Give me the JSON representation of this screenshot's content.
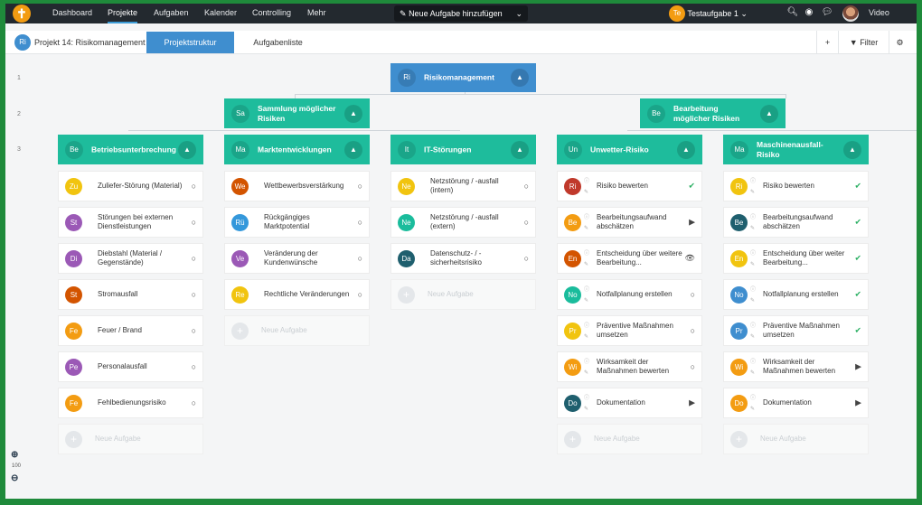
{
  "nav": {
    "logo": "✝",
    "items": [
      "Dashboard",
      "Projekte",
      "Aufgaben",
      "Kalender",
      "Controlling",
      "Mehr"
    ],
    "new_task": "Neue Aufgabe hinzufügen",
    "user_badge": "Te",
    "user_task": "Testaufgabe 1",
    "video": "Video"
  },
  "project": {
    "badge": "Ri",
    "name": "Projekt 14: Risikomanagement",
    "tabs": [
      "Projektstruktur",
      "Aufgabenliste"
    ],
    "filter": "Filter"
  },
  "rows": [
    "1",
    "2",
    "3"
  ],
  "root": {
    "badge": "Ri",
    "title": "Risikomanagement"
  },
  "level2": [
    {
      "badge": "Sa",
      "title": "Sammlung möglicher Risiken"
    },
    {
      "badge": "Be",
      "title": "Bearbeitung möglicher Risiken"
    }
  ],
  "columns": [
    {
      "badge": "Be",
      "title": "Betriebsunterbrechung",
      "tasks": [
        {
          "badge": "Zu",
          "label": "Zuliefer-Störung (Material)",
          "color": "#f1c40f",
          "status": "○"
        },
        {
          "badge": "St",
          "label": "Störungen bei externen Dienstleistungen",
          "color": "#9b59b6",
          "status": "○"
        },
        {
          "badge": "Di",
          "label": "Diebstahl (Material / Gegenstände)",
          "color": "#9b59b6",
          "status": "○"
        },
        {
          "badge": "St",
          "label": "Stromausfall",
          "color": "#d35400",
          "status": "○"
        },
        {
          "badge": "Fe",
          "label": "Feuer / Brand",
          "color": "#f39c12",
          "status": "○"
        },
        {
          "badge": "Pe",
          "label": "Personalausfall",
          "color": "#9b59b6",
          "status": "○"
        },
        {
          "badge": "Fe",
          "label": "Fehlbedienungsrisiko",
          "color": "#f39c12",
          "status": "○"
        }
      ],
      "add": "Neue Aufgabe"
    },
    {
      "badge": "Ma",
      "title": "Marktentwicklungen",
      "tasks": [
        {
          "badge": "We",
          "label": "Wettbewerbsverstärkung",
          "color": "#d35400",
          "status": "○"
        },
        {
          "badge": "Rü",
          "label": "Rückgängiges Marktpotential",
          "color": "#3498db",
          "status": "○"
        },
        {
          "badge": "Ve",
          "label": "Veränderung der Kundenwünsche",
          "color": "#9b59b6",
          "status": "○"
        },
        {
          "badge": "Re",
          "label": "Rechtliche Veränderungen",
          "color": "#f1c40f",
          "status": "○"
        }
      ],
      "add": "Neue Aufgabe"
    },
    {
      "badge": "It",
      "title": "IT-Störungen",
      "tasks": [
        {
          "badge": "Ne",
          "label": "Netzstörung / -ausfall (intern)",
          "color": "#f1c40f",
          "status": "○"
        },
        {
          "badge": "Ne",
          "label": "Netzstörung / -ausfall (extern)",
          "color": "#1abc9c",
          "status": "○"
        },
        {
          "badge": "Da",
          "label": "Datenschutz- / -sicherheitsrisiko",
          "color": "#1f5f6e",
          "status": "○"
        }
      ],
      "add": "Neue Aufgabe"
    },
    {
      "badge": "Un",
      "title": "Unwetter-Risiko",
      "tasks": [
        {
          "badge": "Ri",
          "label": "Risiko bewerten",
          "color": "#c0392b",
          "status": "✔",
          "done": true
        },
        {
          "badge": "Be",
          "label": "Bearbeitungsaufwand abschätzen",
          "color": "#f39c12",
          "status": "▶"
        },
        {
          "badge": "En",
          "label": "Entscheidung über weitere Bearbeitung...",
          "color": "#d35400",
          "status": "👁"
        },
        {
          "badge": "No",
          "label": "Notfallplanung erstellen",
          "color": "#1abc9c",
          "status": "○"
        },
        {
          "badge": "Pr",
          "label": "Präventive Maßnahmen umsetzen",
          "color": "#f1c40f",
          "status": "○"
        },
        {
          "badge": "Wi",
          "label": "Wirksamkeit der Maßnahmen bewerten",
          "color": "#f39c12",
          "status": "○"
        },
        {
          "badge": "Do",
          "label": "Dokumentation",
          "color": "#1f5f6e",
          "status": "▶"
        }
      ],
      "add": "Neue Aufgabe"
    },
    {
      "badge": "Ma",
      "title": "Maschinenausfall-Risiko",
      "tasks": [
        {
          "badge": "Ri",
          "label": "Risiko bewerten",
          "color": "#f1c40f",
          "status": "✔",
          "done": true
        },
        {
          "badge": "Be",
          "label": "Bearbeitungsaufwand abschätzen",
          "color": "#1f5f6e",
          "status": "✔",
          "done": true
        },
        {
          "badge": "En",
          "label": "Entscheidung über weiter Bearbeitung...",
          "color": "#f1c40f",
          "status": "✔",
          "done": true
        },
        {
          "badge": "No",
          "label": "Notfallplanung erstellen",
          "color": "#3f8ecf",
          "status": "✔",
          "done": true
        },
        {
          "badge": "Pr",
          "label": "Präventive Maßnahmen umsetzen",
          "color": "#3f8ecf",
          "status": "✔",
          "done": true
        },
        {
          "badge": "Wi",
          "label": "Wirksamkeit der Maßnahmen bewerten",
          "color": "#f39c12",
          "status": "▶"
        },
        {
          "badge": "Do",
          "label": "Dokumentation",
          "color": "#f39c12",
          "status": "▶"
        }
      ],
      "add": "Neue Aufgabe"
    }
  ],
  "zoom": {
    "value": "100"
  }
}
